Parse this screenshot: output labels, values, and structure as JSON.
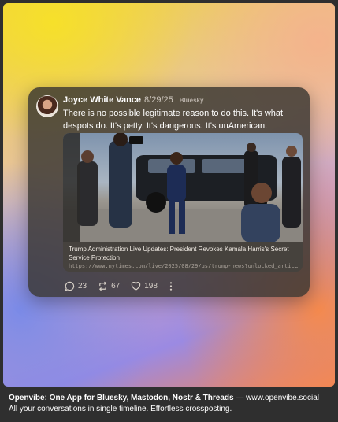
{
  "post": {
    "author": "Joyce White Vance",
    "date": "8/29/25",
    "network": "Bluesky",
    "text": "There is no possible legitimate reason to do this. It's what despots do. It's petty. It's dangerous. It's unAmerican.",
    "link": {
      "title": "Trump Administration Live Updates: President Revokes Kamala Harris's Secret Service Protection",
      "url": "https://www.nytimes.com/live/2025/08/29/us/trump-news?unlocked_article_co..."
    },
    "actions": {
      "replies": "23",
      "reposts": "67",
      "likes": "198"
    }
  },
  "icons": {
    "reply": "speech-bubble-icon",
    "repost": "repost-arrows-icon",
    "like": "heart-icon",
    "more": "vertical-dots-icon"
  },
  "caption": {
    "headline": "Openvibe: One App for Bluesky, Mastodon, Nostr & Threads",
    "separator": " — ",
    "site": "www.openvibe.social",
    "tagline": "All your conversations in single timeline. Effortless crossposting."
  }
}
